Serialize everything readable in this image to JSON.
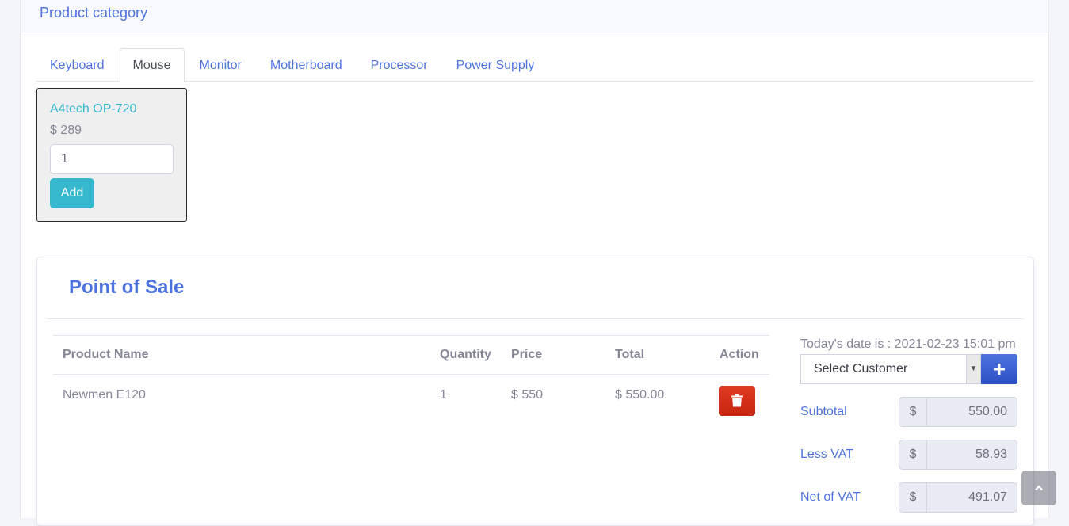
{
  "header": {
    "title": "Product category"
  },
  "tabs": [
    {
      "label": "Keyboard",
      "active": false
    },
    {
      "label": "Mouse",
      "active": true
    },
    {
      "label": "Monitor",
      "active": false
    },
    {
      "label": "Motherboard",
      "active": false
    },
    {
      "label": "Processor",
      "active": false
    },
    {
      "label": "Power Supply",
      "active": false
    }
  ],
  "product": {
    "name": "A4tech OP-720",
    "price": "$ 289",
    "quantity": "1",
    "add_label": "Add"
  },
  "pos": {
    "title": "Point of Sale",
    "columns": [
      "Product Name",
      "Quantity",
      "Price",
      "Total",
      "Action"
    ],
    "rows": [
      {
        "name": "Newmen E120",
        "quantity": "1",
        "price": "$ 550",
        "total": "$ 550.00"
      }
    ],
    "date_text": "Today's date is : 2021-02-23 15:01 pm",
    "customer_select": "Select Customer",
    "add_customer_icon": "plus-icon",
    "summary": [
      {
        "label": "Subtotal",
        "currency": "$",
        "value": "550.00"
      },
      {
        "label": "Less VAT",
        "currency": "$",
        "value": "58.93"
      },
      {
        "label": "Net of VAT",
        "currency": "$",
        "value": "491.07"
      }
    ]
  },
  "colors": {
    "primary": "#4e73df",
    "info": "#36b9cc",
    "danger": "#d52a1a",
    "text": "#858796"
  }
}
